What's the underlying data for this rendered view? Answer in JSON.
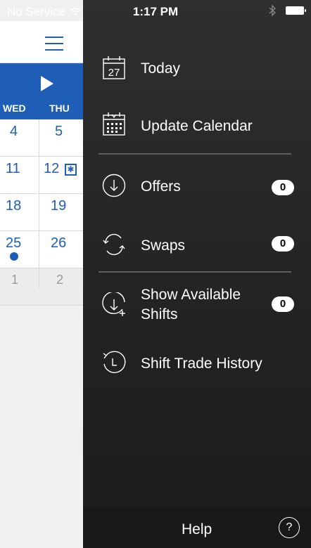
{
  "status_bar": {
    "carrier": "No Service",
    "time": "1:17 PM"
  },
  "calendar": {
    "day_headers": [
      "WED",
      "THU"
    ],
    "rows": [
      {
        "wed": "4",
        "thu": "5"
      },
      {
        "wed": "11",
        "thu": "12"
      },
      {
        "wed": "18",
        "thu": "19"
      },
      {
        "wed": "25",
        "thu": "26"
      },
      {
        "wed": "1",
        "thu": "2"
      }
    ],
    "accent_color": "#1f5eb6"
  },
  "menu": {
    "today": {
      "label": "Today",
      "icon_day": "27"
    },
    "update_calendar": {
      "label": "Update Calendar"
    },
    "offers": {
      "label": "Offers",
      "count": "0"
    },
    "swaps": {
      "label": "Swaps",
      "count": "0"
    },
    "show_available_shifts": {
      "label_line1": "Show Available",
      "label_line2": "Shifts",
      "count": "0"
    },
    "shift_trade_history": {
      "label": "Shift Trade History"
    }
  },
  "footer": {
    "help_label": "Help",
    "help_icon": "?"
  }
}
